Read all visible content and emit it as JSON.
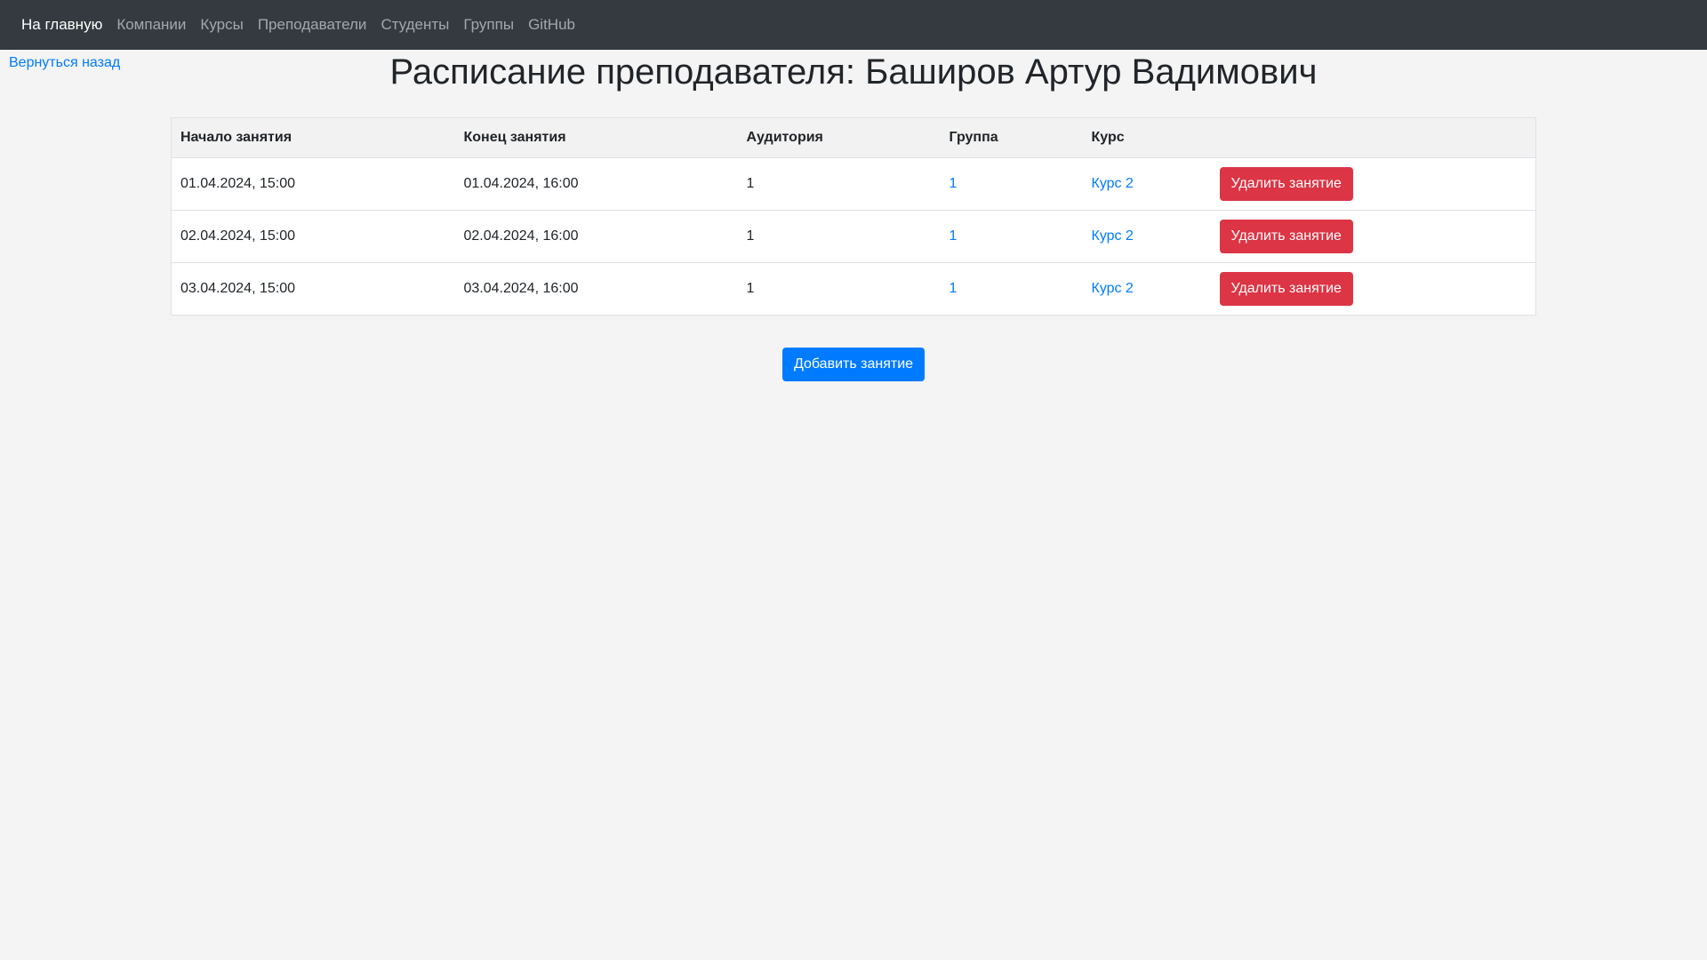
{
  "navbar": {
    "items": [
      {
        "label": "На главную",
        "active": true
      },
      {
        "label": "Компании",
        "active": false
      },
      {
        "label": "Курсы",
        "active": false
      },
      {
        "label": "Преподаватели",
        "active": false
      },
      {
        "label": "Студенты",
        "active": false
      },
      {
        "label": "Группы",
        "active": false
      },
      {
        "label": "GitHub",
        "active": false
      }
    ]
  },
  "back_link": "Вернуться назад",
  "page_title": "Расписание преподавателя: Баширов Артур Вадимович",
  "table": {
    "headers": [
      "Начало занятия",
      "Конец занятия",
      "Аудитория",
      "Группа",
      "Курс",
      ""
    ],
    "rows": [
      {
        "start": "01.04.2024, 15:00",
        "end": "01.04.2024, 16:00",
        "room": "1",
        "group": "1",
        "course": "Курс 2",
        "action": "Удалить занятие"
      },
      {
        "start": "02.04.2024, 15:00",
        "end": "02.04.2024, 16:00",
        "room": "1",
        "group": "1",
        "course": "Курс 2",
        "action": "Удалить занятие"
      },
      {
        "start": "03.04.2024, 15:00",
        "end": "03.04.2024, 16:00",
        "room": "1",
        "group": "1",
        "course": "Курс 2",
        "action": "Удалить занятие"
      }
    ]
  },
  "add_button": "Добавить занятие",
  "colors": {
    "navbar_bg": "#343a40",
    "link": "#007bff",
    "danger": "#dc3545",
    "primary": "#007bff",
    "page_bg": "#f4f4f4"
  }
}
